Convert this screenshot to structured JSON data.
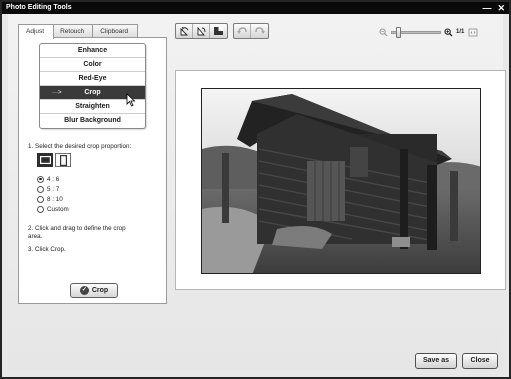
{
  "window": {
    "title": "Photo Editing Tools",
    "minimize_glyph": "—",
    "close_glyph": "✕"
  },
  "tabs": [
    {
      "label": "Adjust",
      "active": true
    },
    {
      "label": "Retouch",
      "active": false
    },
    {
      "label": "Clipboard",
      "active": false
    }
  ],
  "menu": {
    "items": [
      {
        "label": "Enhance"
      },
      {
        "label": "Color"
      },
      {
        "label": "Red-Eye"
      },
      {
        "label": "Crop",
        "selected": true
      },
      {
        "label": "Straighten"
      },
      {
        "label": "Blur Background"
      }
    ],
    "selected_arrow": "···>"
  },
  "crop": {
    "step1": "1. Select the desired crop proportion:",
    "proportions": [
      {
        "label": "4 : 6",
        "checked": true
      },
      {
        "label": "5 : 7",
        "checked": false
      },
      {
        "label": "8 : 10",
        "checked": false
      },
      {
        "label": "Custom",
        "checked": false
      }
    ],
    "orientation": [
      "landscape",
      "portrait"
    ],
    "orientation_selected": "landscape",
    "step2": "2. Click and drag to define the crop area.",
    "step3": "3. Click Crop.",
    "button_label": "Crop",
    "button_icon": "checkmark-icon"
  },
  "toolbar": {
    "icons": [
      "rotate-left-icon",
      "rotate-right-icon",
      "compare-icon",
      "undo-icon",
      "redo-icon"
    ]
  },
  "zoom": {
    "label": "1/1",
    "level": 0.1,
    "icons": [
      "zoom-out-icon",
      "zoom-in-icon",
      "fit-screen-icon"
    ]
  },
  "footer": {
    "save_as_label": "Save as",
    "close_label": "Close"
  },
  "colors": {
    "titlebar": "#0a0a0a",
    "selected_item": "#3a3a3a",
    "panel_border": "#9a9a9a"
  }
}
